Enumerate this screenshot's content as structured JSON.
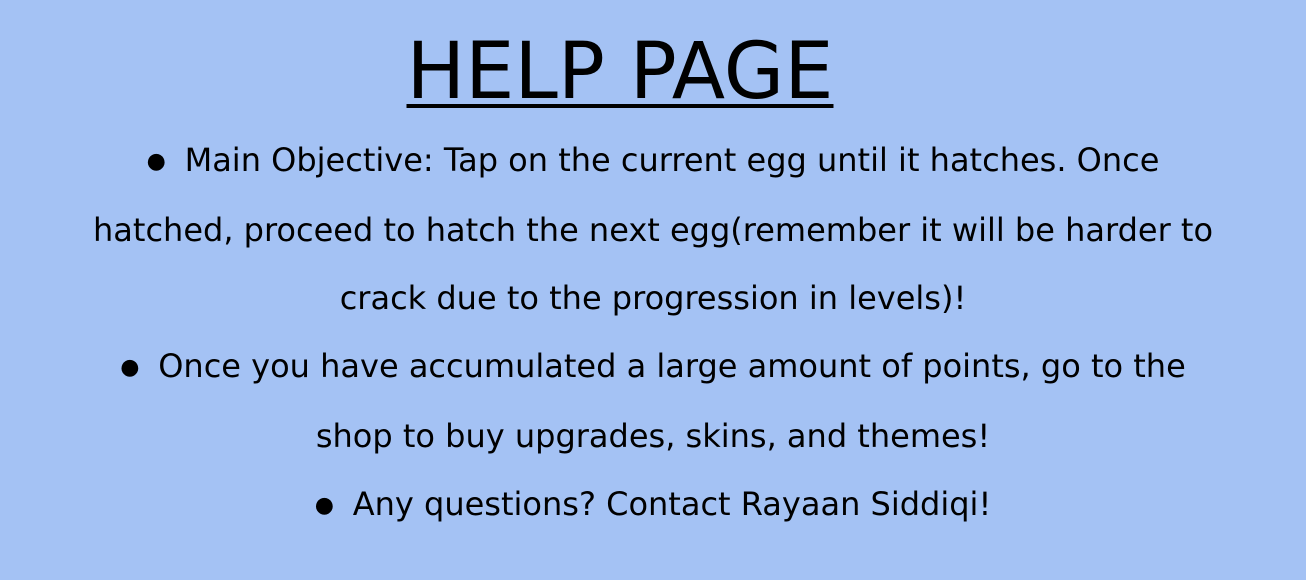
{
  "title": "HELP PAGE",
  "items": [
    {
      "text": "Main Objective: Tap on the current egg until it hatches. Once hatched, proceed to hatch the next egg(remember it will be harder to crack due to the progression in levels)!"
    },
    {
      "text": "Once you have accumulated a large amount of points, go to the shop to buy upgrades, skins, and themes!"
    },
    {
      "text": "Any questions? Contact Rayaan Siddiqi!"
    }
  ],
  "bullet_char": "●",
  "colors": {
    "background": "#a4c2f4",
    "text": "#000000"
  }
}
